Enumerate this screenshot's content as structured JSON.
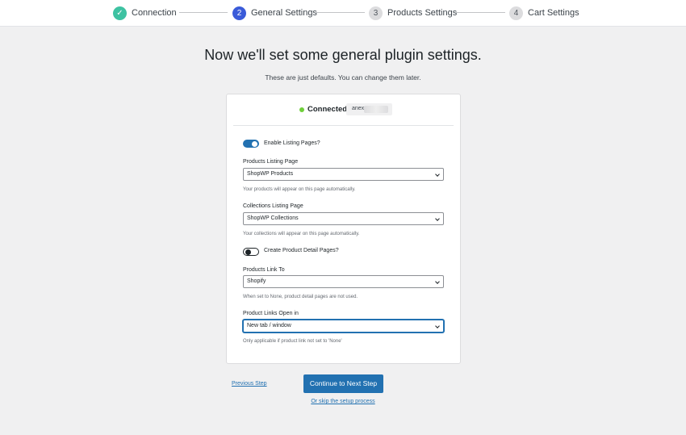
{
  "stepper": {
    "steps": [
      {
        "number": "✓",
        "label": "Connection",
        "state": "done"
      },
      {
        "number": "2",
        "label": "General Settings",
        "state": "active"
      },
      {
        "number": "3",
        "label": "Products Settings",
        "state": "todo"
      },
      {
        "number": "4",
        "label": "Cart Settings",
        "state": "todo"
      }
    ]
  },
  "header": {
    "title": "Now we'll set some general plugin settings.",
    "subtitle": "These are just defaults. You can change them later."
  },
  "connection": {
    "status_label": "Connected",
    "status_color": "#6fcf3a",
    "store_prefix": "anex"
  },
  "form": {
    "enable_listing": {
      "label": "Enable Listing Pages?",
      "enabled": true
    },
    "products_listing": {
      "label": "Products Listing Page",
      "value": "ShopWP Products",
      "help": "Your products will appear on this page automatically."
    },
    "collections_listing": {
      "label": "Collections Listing Page",
      "value": "ShopWP Collections",
      "help": "Your collections will appear on this page automatically."
    },
    "detail_pages": {
      "label": "Create Product Detail Pages?",
      "enabled": false
    },
    "products_link_to": {
      "label": "Products Link To",
      "value": "Shopify",
      "help": "When set to None, product detail pages are not used."
    },
    "links_open_in": {
      "label": "Product Links Open in",
      "value": "New tab / window",
      "help": "Only applicable if product link not set to 'None'"
    }
  },
  "actions": {
    "previous_label": "Previous Step",
    "next_label": "Continue to Next Step",
    "skip_label": "Or skip the setup process",
    "accent": "#2271b1"
  }
}
